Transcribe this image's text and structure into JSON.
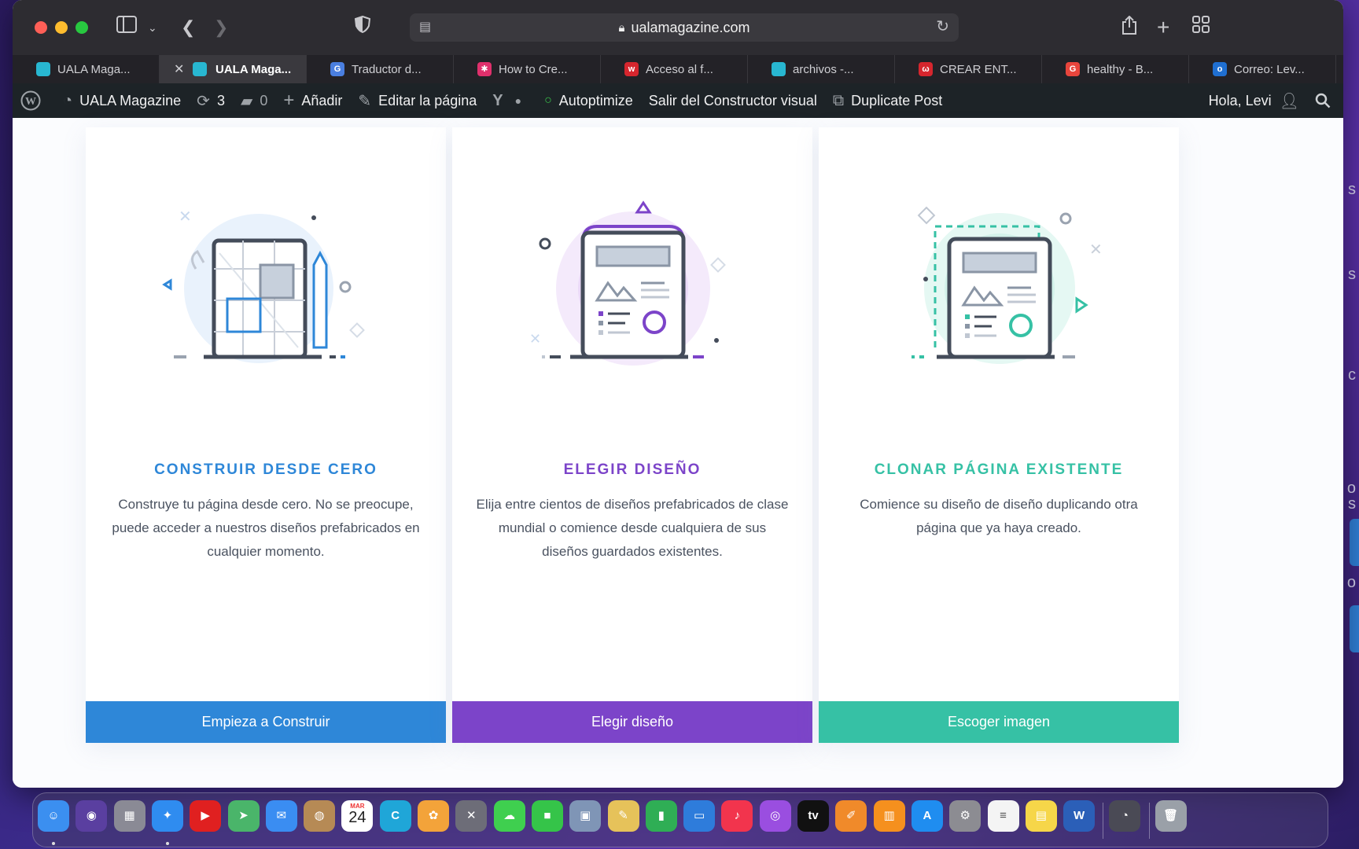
{
  "browser": {
    "url": "ualamagazine.com",
    "tabs": [
      {
        "label": "UALA Maga...",
        "active": false,
        "fav": "",
        "color": "#28b7d1"
      },
      {
        "label": "UALA Maga...",
        "active": true,
        "fav": "",
        "color": "#28b7d1"
      },
      {
        "label": "Traductor d...",
        "active": false,
        "fav": "G",
        "color": "#4a7fe0"
      },
      {
        "label": "How to Cre...",
        "active": false,
        "fav": "✱",
        "color": "#e0306c"
      },
      {
        "label": "Acceso al f...",
        "active": false,
        "fav": "w",
        "color": "#d6262e"
      },
      {
        "label": "archivos -...",
        "active": false,
        "fav": "",
        "color": "#28b7d1"
      },
      {
        "label": "CREAR ENT...",
        "active": false,
        "fav": "ω",
        "color": "#d6262e"
      },
      {
        "label": "healthy - B...",
        "active": false,
        "fav": "G",
        "color": "#e8453c"
      },
      {
        "label": "Correo: Lev...",
        "active": false,
        "fav": "o",
        "color": "#1f6fd1"
      }
    ]
  },
  "adminbar": {
    "site": "UALA Magazine",
    "updates": "3",
    "comments": "0",
    "add": "Añadir",
    "edit": "Editar la página",
    "autoptimize": "Autoptimize",
    "exit_builder": "Salir del Constructor visual",
    "duplicate": "Duplicate Post",
    "greeting": "Hola, Levi"
  },
  "cards": [
    {
      "title": "CONSTRUIR DESDE CERO",
      "description": "Construye tu página desde cero. No se preocupe, puede acceder a nuestros diseños prefabricados en cualquier momento.",
      "button": "Empieza a Construir",
      "color": "#2e87d8"
    },
    {
      "title": "ELEGIR DISEÑO",
      "description": "Elija entre cientos de diseños prefabricados de clase mundial o comience desde cualquiera de sus diseños guardados existentes.",
      "button": "Elegir diseño",
      "color": "#7c44c9"
    },
    {
      "title": "CLONAR PÁGINA EXISTENTE",
      "description": "Comience su diseño de diseño duplicando otra página que ya haya creado.",
      "button": "Escoger imagen",
      "color": "#36c1a5"
    }
  ],
  "dock": {
    "calendar_month": "MAR",
    "calendar_day": "24",
    "apps": [
      {
        "name": "Finder",
        "color": "#3b8ff0",
        "glyph": "☺"
      },
      {
        "name": "Siri",
        "color": "#5a3fa0",
        "glyph": "◉"
      },
      {
        "name": "Launchpad",
        "color": "#8a8a95",
        "glyph": "▦"
      },
      {
        "name": "Safari",
        "color": "#2f8cf0",
        "glyph": "✦"
      },
      {
        "name": "YouTube",
        "color": "#e02020",
        "glyph": "▶"
      },
      {
        "name": "Maps",
        "color": "#4ab56a",
        "glyph": "➤"
      },
      {
        "name": "Mail",
        "color": "#3a8df2",
        "glyph": "✉"
      },
      {
        "name": "Contacts",
        "color": "#b68a55",
        "glyph": "◍"
      },
      {
        "name": "Calendar",
        "color": "#ffffff",
        "glyph": ""
      },
      {
        "name": "Canva",
        "color": "#1fa6d8",
        "glyph": "C"
      },
      {
        "name": "Photos",
        "color": "#f3a33a",
        "glyph": "✿"
      },
      {
        "name": "Instruments",
        "color": "#6d6d78",
        "glyph": "✕"
      },
      {
        "name": "Messages",
        "color": "#3fcf4f",
        "glyph": "☁"
      },
      {
        "name": "FaceTime",
        "color": "#35c449",
        "glyph": "■"
      },
      {
        "name": "Preview",
        "color": "#7f95b6",
        "glyph": "▣"
      },
      {
        "name": "TextEdit",
        "color": "#e6c25a",
        "glyph": "✎"
      },
      {
        "name": "Numbers",
        "color": "#2fae55",
        "glyph": "▮"
      },
      {
        "name": "Keynote",
        "color": "#2e7cdb",
        "glyph": "▭"
      },
      {
        "name": "Music",
        "color": "#f2344d",
        "glyph": "♪"
      },
      {
        "name": "Podcasts",
        "color": "#9a4ee0",
        "glyph": "◎"
      },
      {
        "name": "TV",
        "color": "#111111",
        "glyph": "tv"
      },
      {
        "name": "Pages",
        "color": "#f08a2a",
        "glyph": "✐"
      },
      {
        "name": "Books",
        "color": "#f5901e",
        "glyph": "▥"
      },
      {
        "name": "App Store",
        "color": "#1f8df0",
        "glyph": "A"
      },
      {
        "name": "System Preferences",
        "color": "#8c8c92",
        "glyph": "⚙"
      },
      {
        "name": "Reminders",
        "color": "#f4f4f4",
        "glyph": "≡"
      },
      {
        "name": "Notes",
        "color": "#f6d649",
        "glyph": "▤"
      },
      {
        "name": "Word",
        "color": "#2b5fb8",
        "glyph": "W"
      },
      {
        "name": "QuickTime",
        "color": "#4a4a55",
        "glyph": "◔"
      },
      {
        "name": "Trash",
        "color": "#9aa0a8",
        "glyph": "🗑"
      }
    ]
  }
}
